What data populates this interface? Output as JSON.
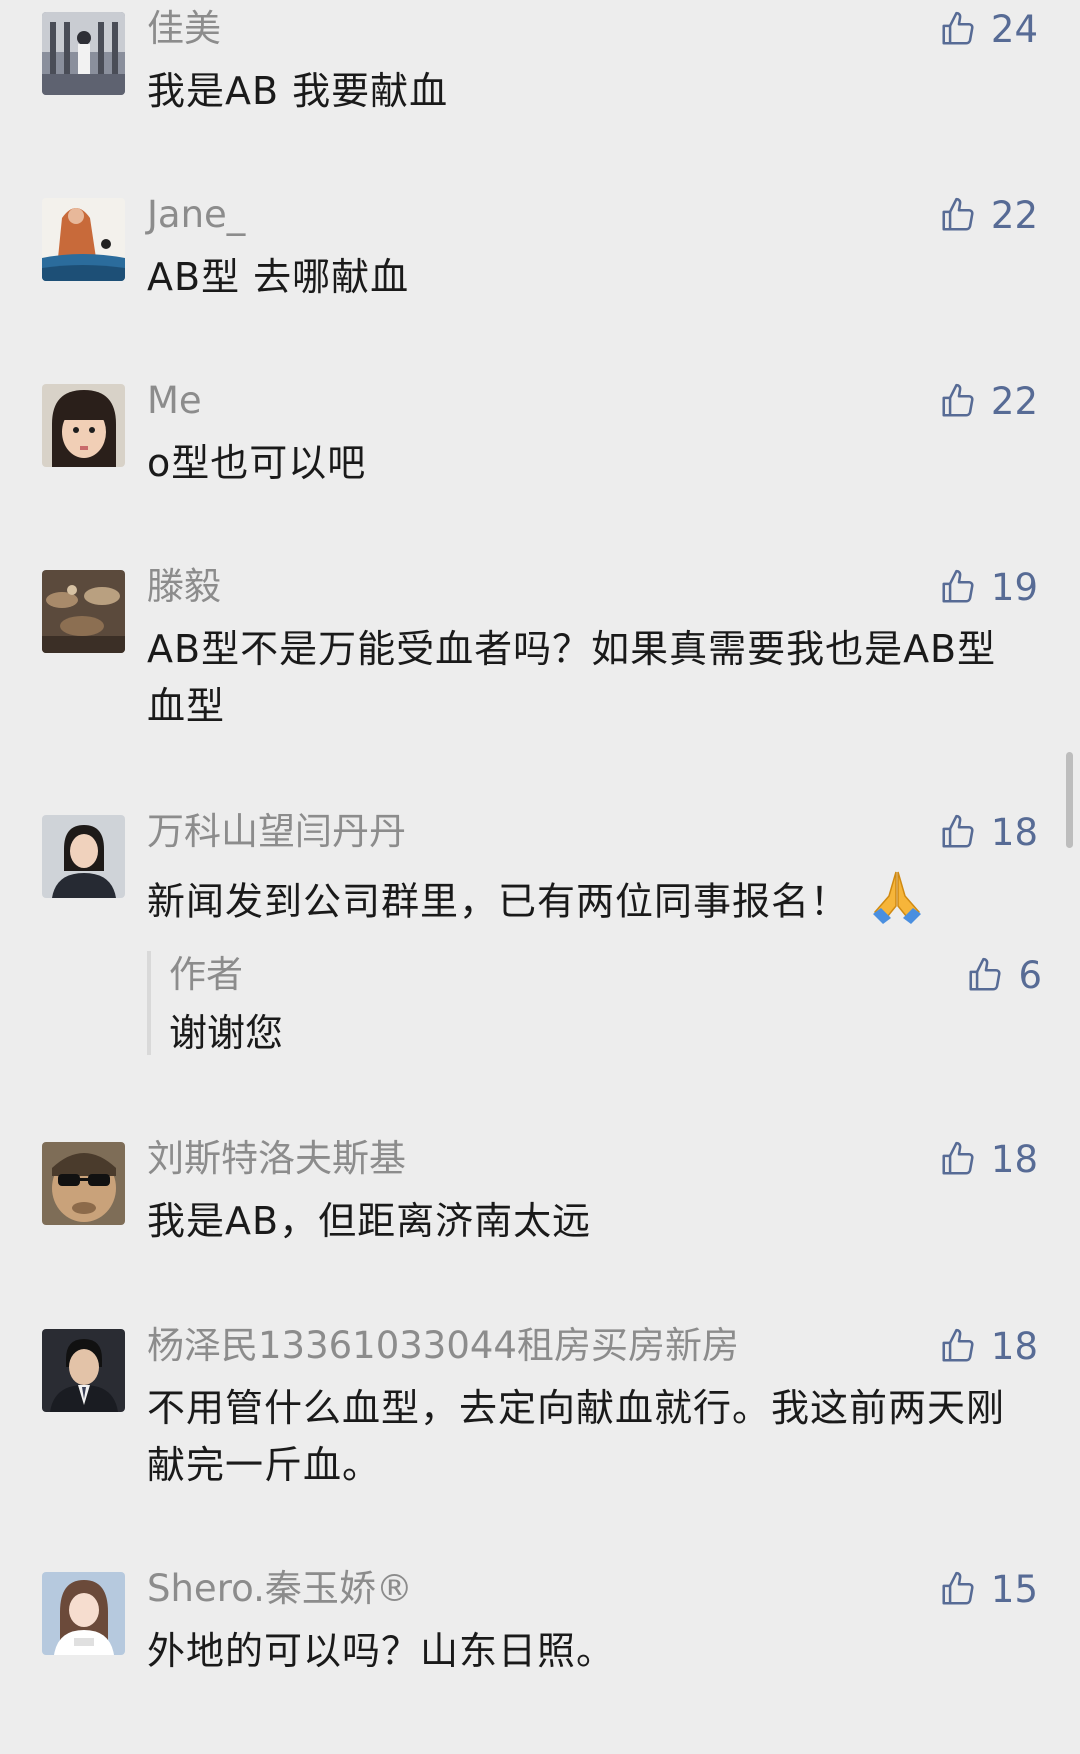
{
  "comments": [
    {
      "name": "佳美",
      "text": "我是AB  我要献血",
      "likes": "24"
    },
    {
      "name": "Jane_",
      "text": "AB型 去哪献血",
      "likes": "22"
    },
    {
      "name": "Me",
      "text": "o型也可以吧",
      "likes": "22"
    },
    {
      "name": "滕毅",
      "text": "AB型不是万能受血者吗？如果真需要我也是AB型血型",
      "likes": "19"
    },
    {
      "name": "万科山望闫丹丹",
      "text": "新闻发到公司群里，已有两位同事报名！",
      "likes": "18",
      "reply": {
        "name": "作者",
        "text": "谢谢您",
        "likes": "6"
      }
    },
    {
      "name": "刘斯特洛夫斯基",
      "text": "我是AB，但距离济南太远",
      "likes": "18"
    },
    {
      "name": "杨泽民13361033044租房买房新房",
      "text": "不用管什么血型，去定向献血就行。我这前两天刚献完一斤血。",
      "likes": "18"
    },
    {
      "name": "Shero.秦玉娇®",
      "text": "外地的可以吗？山东日照。",
      "likes": "15"
    }
  ],
  "icons": {
    "like": "thumbs-up-icon",
    "emoji": "folded-hands-icon"
  },
  "colors": {
    "background": "#ededed",
    "name": "#8c8c8c",
    "text": "#1a1a1a",
    "like": "#576b95"
  }
}
